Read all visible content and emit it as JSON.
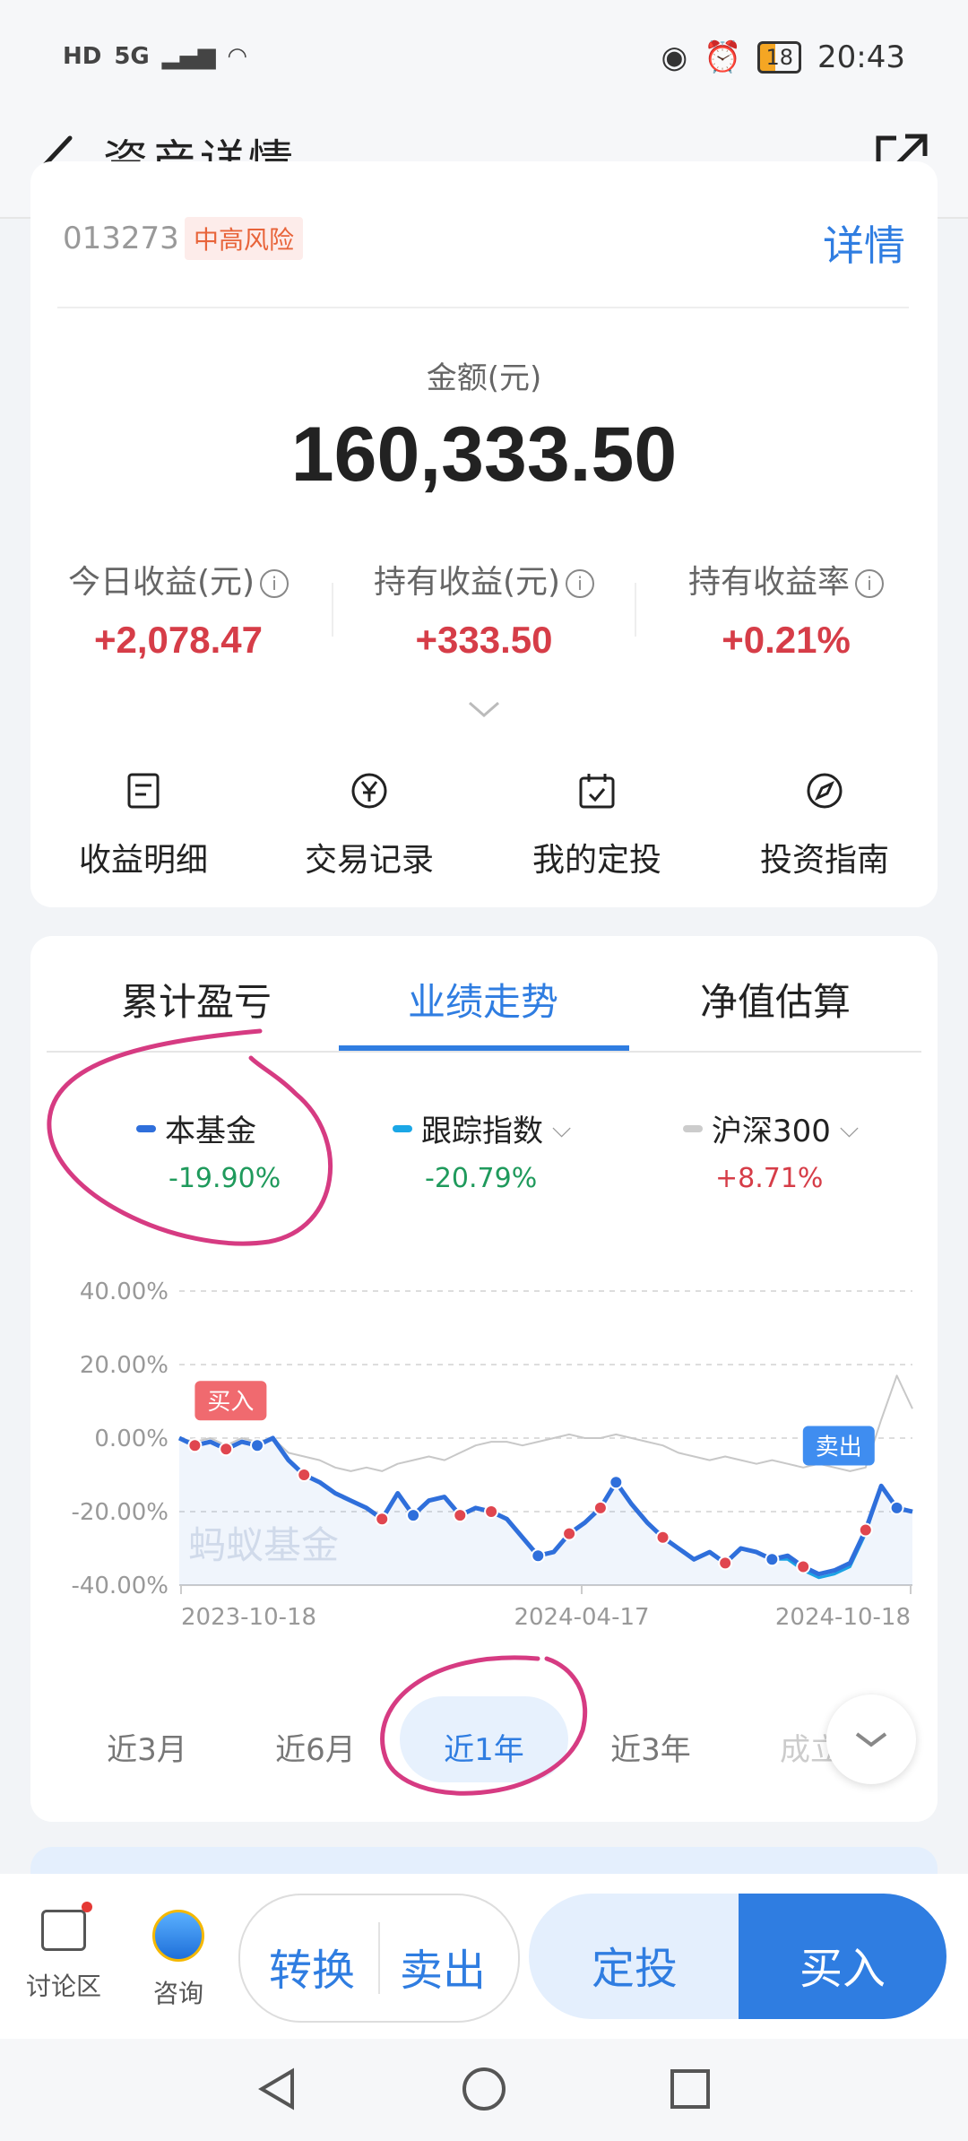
{
  "status": {
    "left": [
      "HD",
      "5G",
      "▮▮▮",
      "wifi"
    ],
    "battery": "18",
    "time": "20:43"
  },
  "header": {
    "title": "资产详情"
  },
  "fund": {
    "code": "013273",
    "risk": "中高风险",
    "detail_link": "详情",
    "amount_label": "金额(元)",
    "amount": "160,333.50",
    "stats": [
      {
        "label": "今日收益(元)",
        "value": "+2,078.47"
      },
      {
        "label": "持有收益(元)",
        "value": "+333.50"
      },
      {
        "label": "持有收益率",
        "value": "+0.21%"
      }
    ],
    "actions": [
      {
        "label": "收益明细",
        "icon": "document-icon"
      },
      {
        "label": "交易记录",
        "icon": "yuan-icon"
      },
      {
        "label": "我的定投",
        "icon": "calendar-icon"
      },
      {
        "label": "投资指南",
        "icon": "compass-icon"
      }
    ]
  },
  "tabs": [
    {
      "label": "累计盈亏"
    },
    {
      "label": "业绩走势"
    },
    {
      "label": "净值估算"
    }
  ],
  "legend": [
    {
      "name": "本基金",
      "pct": "-19.90%",
      "color": "#2f6fdb",
      "pct_color": "#1f9a5c"
    },
    {
      "name": "跟踪指数",
      "pct": "-20.79%",
      "color": "#1ba7e6",
      "pct_color": "#1f9a5c"
    },
    {
      "name": "沪深300",
      "pct": "+8.71%",
      "color": "#cccccc",
      "pct_color": "#d63d48"
    }
  ],
  "chart_data": {
    "type": "line",
    "x_ticks": [
      "2023-10-18",
      "2024-04-17",
      "2024-10-18"
    ],
    "y_ticks": [
      "40.00%",
      "20.00%",
      "0.00%",
      "-20.00%",
      "-40.00%"
    ],
    "ylim": [
      -40,
      40
    ],
    "watermark": "蚂蚁基金",
    "annotations": [
      {
        "label": "买入"
      },
      {
        "label": "卖出"
      }
    ],
    "series": [
      {
        "name": "本基金",
        "values": [
          0,
          -2,
          -1,
          -3,
          -1,
          -2,
          0,
          -6,
          -10,
          -12,
          -15,
          -17,
          -19,
          -22,
          -15,
          -21,
          -17,
          -16,
          -21,
          -19,
          -20,
          -22,
          -27,
          -32,
          -31,
          -26,
          -23,
          -19,
          -12,
          -18,
          -23,
          -27,
          -30,
          -33,
          -31,
          -34,
          -30,
          -31,
          -33,
          -32,
          -35,
          -37,
          -36,
          -34,
          -25,
          -13,
          -19,
          -20
        ]
      },
      {
        "name": "跟踪指数",
        "values": [
          0,
          -2,
          -1,
          -3,
          -1,
          -2,
          0,
          -6,
          -10,
          -12,
          -15,
          -17,
          -19,
          -22,
          -15,
          -21,
          -17,
          -16,
          -21,
          -19,
          -20,
          -22,
          -27,
          -32,
          -31,
          -26,
          -23,
          -19,
          -12,
          -18,
          -23,
          -27,
          -30,
          -33,
          -31,
          -34,
          -30,
          -31,
          -33,
          -33,
          -36,
          -38,
          -37,
          -35,
          -26,
          -13,
          -19,
          -20
        ]
      },
      {
        "name": "沪深300",
        "values": [
          0,
          -1,
          0,
          -2,
          0,
          -1,
          0,
          -4,
          -5,
          -6,
          -8,
          -9,
          -8,
          -9,
          -7,
          -6,
          -5,
          -6,
          -4,
          -2,
          -1,
          -1,
          -2,
          -1,
          0,
          1,
          0,
          0,
          1,
          0,
          -1,
          -2,
          -4,
          -5,
          -6,
          -5,
          -6,
          -7,
          -6,
          -7,
          -8,
          -7,
          -8,
          -9,
          -8,
          5,
          17,
          8
        ]
      }
    ]
  },
  "periods": [
    {
      "label": "近3月"
    },
    {
      "label": "近6月"
    },
    {
      "label": "近1年"
    },
    {
      "label": "近3年"
    },
    {
      "label": "成立"
    }
  ],
  "bottom": {
    "discuss": "讨论区",
    "consult": "咨询",
    "convert": "转换",
    "sell": "卖出",
    "dingtou": "定投",
    "buy": "买入"
  }
}
